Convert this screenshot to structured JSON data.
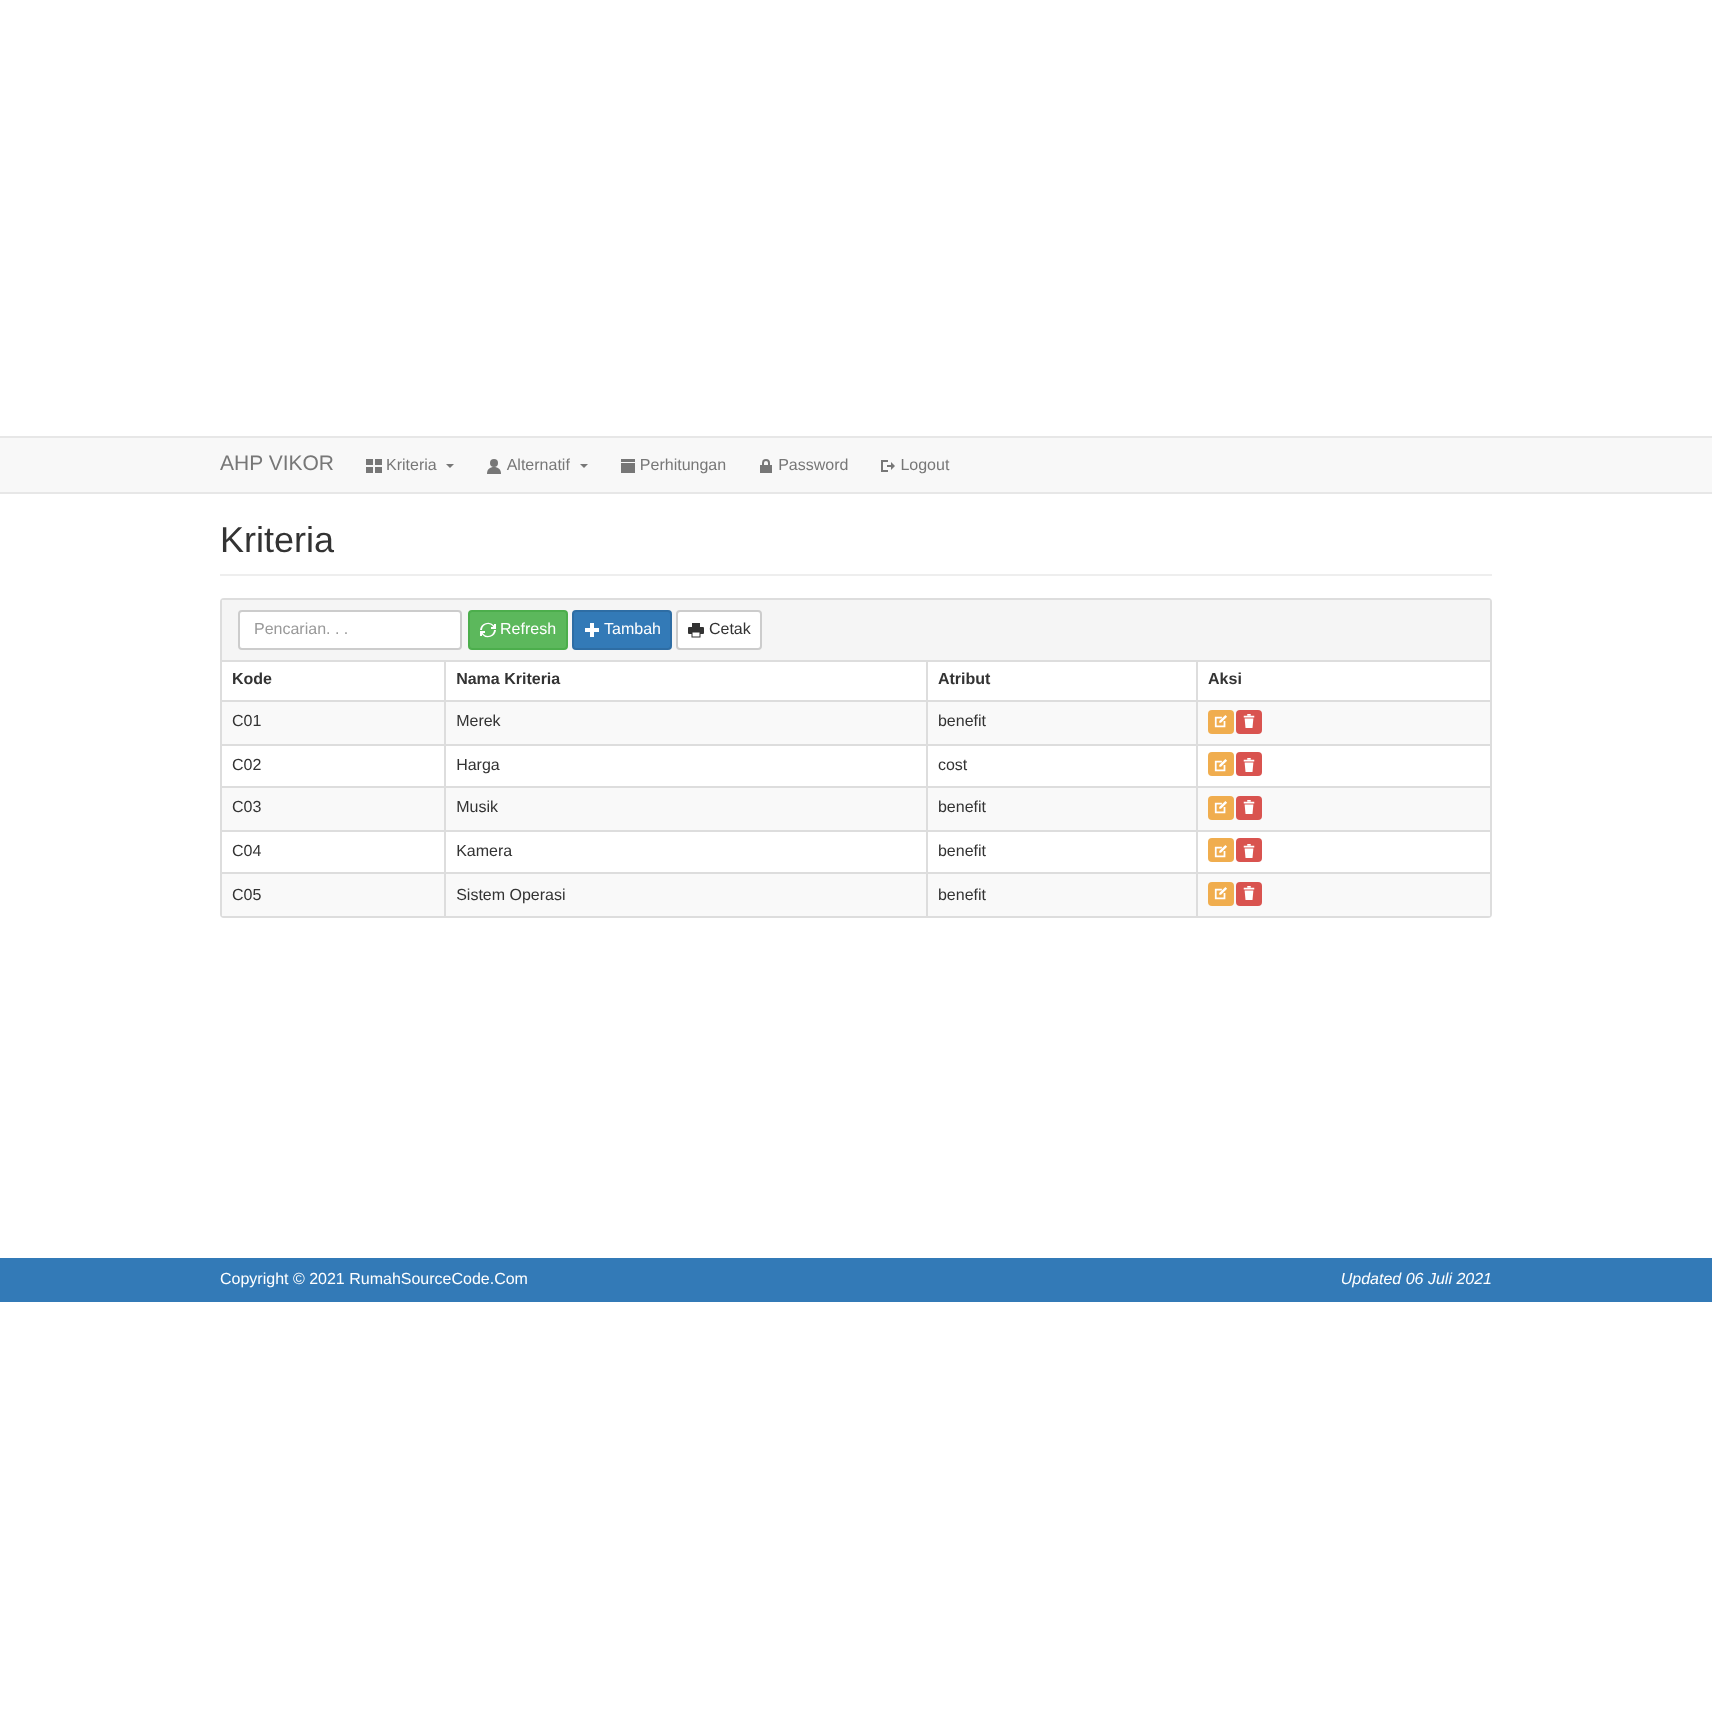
{
  "navbar": {
    "brand": "AHP VIKOR",
    "items": [
      {
        "label": "Kriteria",
        "dropdown": true
      },
      {
        "label": "Alternatif",
        "dropdown": true
      },
      {
        "label": "Perhitungan",
        "dropdown": false
      },
      {
        "label": "Password",
        "dropdown": false
      },
      {
        "label": "Logout",
        "dropdown": false
      }
    ]
  },
  "page": {
    "title": "Kriteria"
  },
  "toolbar": {
    "search": {
      "placeholder": "Pencarian. . ."
    },
    "buttons": [
      {
        "label": "Refresh",
        "kind": "success"
      },
      {
        "label": "Tambah",
        "kind": "primary"
      },
      {
        "label": "Cetak",
        "kind": "default"
      }
    ]
  },
  "table": {
    "columns": [
      "Kode",
      "Nama Kriteria",
      "Atribut",
      "Aksi"
    ],
    "rows": [
      [
        "C01",
        "Merek",
        "benefit"
      ],
      [
        "C02",
        "Harga",
        "cost"
      ],
      [
        "C03",
        "Musik",
        "benefit"
      ],
      [
        "C04",
        "Kamera",
        "benefit"
      ],
      [
        "C05",
        "Sistem Operasi",
        "benefit"
      ]
    ]
  },
  "footer": {
    "left": "Copyright © 2021 RumahSourceCode.Com",
    "right": "Updated 06 Juli 2021"
  }
}
